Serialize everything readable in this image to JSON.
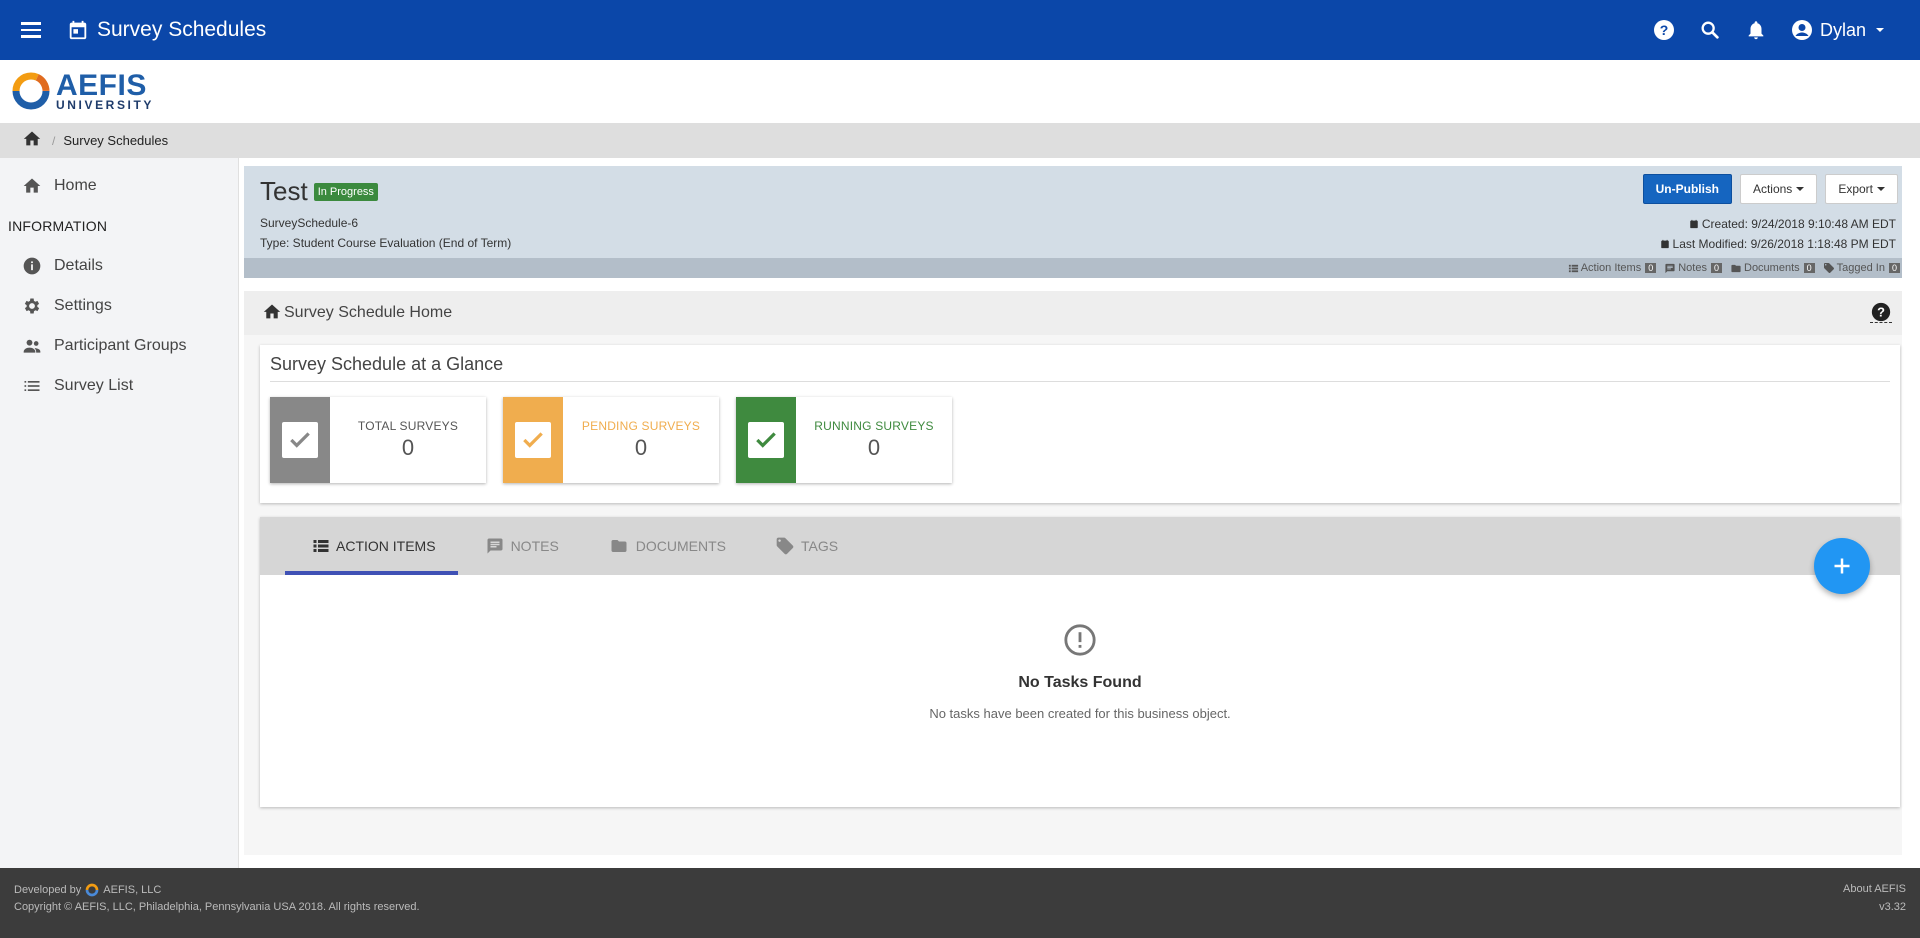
{
  "topbar": {
    "title": "Survey Schedules",
    "user_name": "Dylan"
  },
  "logo": {
    "name": "AEFIS",
    "subtitle": "UNIVERSITY"
  },
  "breadcrumb": {
    "current": "Survey Schedules"
  },
  "sidebar": {
    "home_label": "Home",
    "section_label": "INFORMATION",
    "items": [
      {
        "label": "Details",
        "icon": "info-icon"
      },
      {
        "label": "Settings",
        "icon": "gear-icon"
      },
      {
        "label": "Participant Groups",
        "icon": "people-icon"
      },
      {
        "label": "Survey List",
        "icon": "list-icon"
      }
    ]
  },
  "record": {
    "title": "Test",
    "status": "In Progress",
    "id": "SurveySchedule-6",
    "type": "Type: Student Course Evaluation (End of Term)",
    "created": "Created: 9/24/2018 9:10:48 AM EDT",
    "modified": "Last Modified: 9/26/2018 1:18:48 PM EDT",
    "buttons": {
      "unpublish": "Un-Publish",
      "actions": "Actions",
      "export": "Export"
    },
    "counts": [
      {
        "label": "Action Items",
        "value": "0"
      },
      {
        "label": "Notes",
        "value": "0"
      },
      {
        "label": "Documents",
        "value": "0"
      },
      {
        "label": "Tagged In",
        "value": "0"
      }
    ]
  },
  "subhead": {
    "title": "Survey Schedule Home"
  },
  "glance": {
    "title": "Survey Schedule at a Glance",
    "stats": [
      {
        "label": "TOTAL SURVEYS",
        "value": "0",
        "color": "#888888",
        "label_color": "#555555"
      },
      {
        "label": "PENDING SURVEYS",
        "value": "0",
        "color": "#f0ad4e",
        "label_color": "#f0ad4e"
      },
      {
        "label": "RUNNING SURVEYS",
        "value": "0",
        "color": "#3f8a3f",
        "label_color": "#3f8a3f"
      }
    ]
  },
  "tabs": {
    "items": [
      "ACTION ITEMS",
      "NOTES",
      "DOCUMENTS",
      "TAGS"
    ],
    "active": "ACTION ITEMS"
  },
  "empty": {
    "title": "No Tasks Found",
    "description": "No tasks have been created for this business object."
  },
  "footer": {
    "developed_by": "Developed by",
    "company": "AEFIS, LLC",
    "copyright": "Copyright © AEFIS, LLC, Philadelphia, Pennsylvania USA 2018. All rights reserved.",
    "about": "About AEFIS",
    "version": "v3.32"
  },
  "colors": {
    "topbar": "#0b47a9",
    "primary_button": "#1565c0",
    "fab": "#2196f3",
    "status_badge": "#3b8a3e",
    "active_tab_underline": "#3f51b5"
  }
}
